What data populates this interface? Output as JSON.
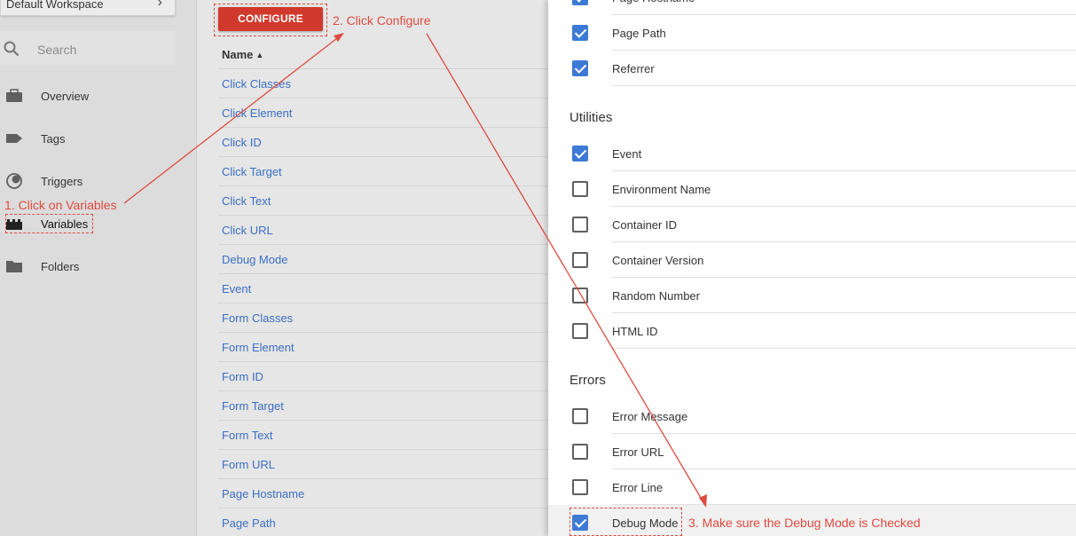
{
  "sidebar": {
    "workspace": "Default Workspace",
    "search_placeholder": "Search",
    "items": [
      {
        "label": "Overview",
        "icon": "briefcase-icon"
      },
      {
        "label": "Tags",
        "icon": "tag-icon"
      },
      {
        "label": "Triggers",
        "icon": "trigger-icon"
      },
      {
        "label": "Variables",
        "icon": "variables-icon"
      },
      {
        "label": "Folders",
        "icon": "folder-icon"
      }
    ]
  },
  "variables_list": {
    "configure_label": "CONFIGURE",
    "column_header": "Name",
    "rows": [
      "Click Classes",
      "Click Element",
      "Click ID",
      "Click Target",
      "Click Text",
      "Click URL",
      "Debug Mode",
      "Event",
      "Form Classes",
      "Form Element",
      "Form ID",
      "Form Target",
      "Form Text",
      "Form URL",
      "Page Hostname",
      "Page Path"
    ]
  },
  "panel": {
    "top_items": [
      {
        "label": "Page Hostname",
        "checked": true
      },
      {
        "label": "Page Path",
        "checked": true
      },
      {
        "label": "Referrer",
        "checked": true
      }
    ],
    "utilities": {
      "title": "Utilities",
      "items": [
        {
          "label": "Event",
          "checked": true
        },
        {
          "label": "Environment Name",
          "checked": false
        },
        {
          "label": "Container ID",
          "checked": false
        },
        {
          "label": "Container Version",
          "checked": false
        },
        {
          "label": "Random Number",
          "checked": false
        },
        {
          "label": "HTML ID",
          "checked": false
        }
      ]
    },
    "errors": {
      "title": "Errors",
      "items": [
        {
          "label": "Error Message",
          "checked": false
        },
        {
          "label": "Error URL",
          "checked": false
        },
        {
          "label": "Error Line",
          "checked": false
        },
        {
          "label": "Debug Mode",
          "checked": true
        }
      ]
    }
  },
  "annotations": {
    "step1": "1. Click on Variables",
    "step2": "2. Click Configure",
    "step3": "3. Make sure the Debug Mode is Checked"
  },
  "colors": {
    "accent": "#d0392b",
    "annotation": "#e04a3f",
    "link": "#3b6fc4",
    "checkbox": "#3d7ad6"
  }
}
